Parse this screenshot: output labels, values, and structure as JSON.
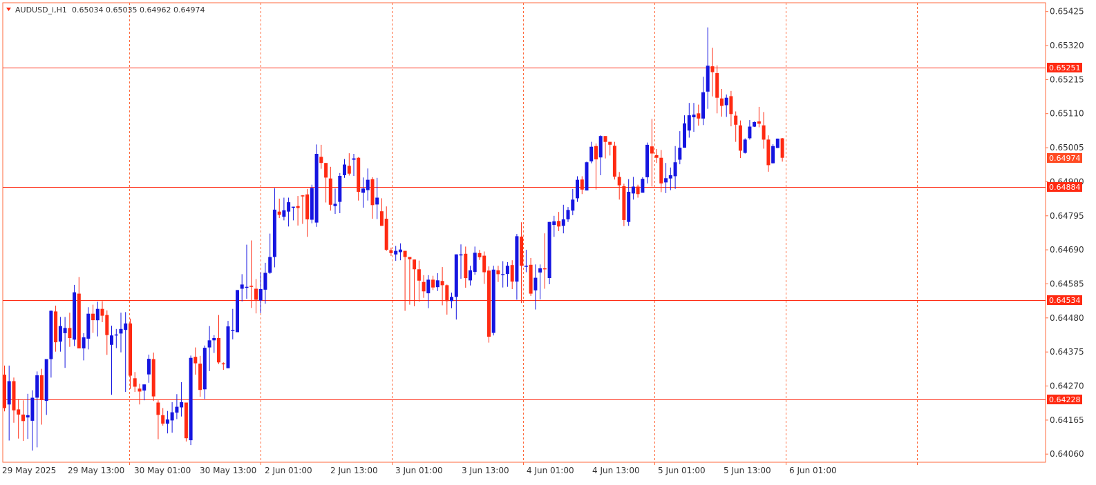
{
  "header": {
    "symbol": "AUDUSD_i,H1",
    "ohlc_text": "0.65034 0.65035 0.64962 0.64974"
  },
  "colors": {
    "bull": "#1515e0",
    "bear": "#ff2a12",
    "grid": "#ff6a3d",
    "axis": "#ff6a3d",
    "hline": "#ff2a12",
    "tag_bg": "#ff2a12",
    "current_tag_bg": "#ff4a22"
  },
  "chart_data": {
    "type": "candlestick",
    "timeframe": "H1",
    "symbol": "AUDUSD_i",
    "y_axis_ticks": [
      "0.65425",
      "0.65320",
      "0.65215",
      "0.65110",
      "0.65005",
      "0.64900",
      "0.64795",
      "0.64690",
      "0.64585",
      "0.64480",
      "0.64375",
      "0.64270",
      "0.64165",
      "0.64060"
    ],
    "ylim": [
      0.64035,
      0.65452
    ],
    "x_axis_labels": [
      "29 May 2025",
      "29 May 13:00",
      "30 May 01:00",
      "30 May 13:00",
      "2 Jun 01:00",
      "2 Jun 13:00",
      "3 Jun 01:00",
      "3 Jun 13:00",
      "4 Jun 01:00",
      "4 Jun 13:00",
      "5 Jun 01:00",
      "5 Jun 13:00",
      "6 Jun 01:00"
    ],
    "horizontal_levels": [
      {
        "value": "0.65251",
        "price": 0.65251
      },
      {
        "value": "0.64884",
        "price": 0.64884
      },
      {
        "value": "0.64534",
        "price": 0.64534
      },
      {
        "value": "0.64228",
        "price": 0.64228
      }
    ],
    "current_price": {
      "value": "0.64974",
      "price": 0.64974
    },
    "candles": [
      {
        "o": 0.64305,
        "h": 0.64333,
        "l": 0.64192,
        "c": 0.64202
      },
      {
        "o": 0.64213,
        "h": 0.64333,
        "l": 0.64102,
        "c": 0.64285
      },
      {
        "o": 0.64285,
        "h": 0.64296,
        "l": 0.64157,
        "c": 0.64195
      },
      {
        "o": 0.64198,
        "h": 0.6423,
        "l": 0.64108,
        "c": 0.64182
      },
      {
        "o": 0.64182,
        "h": 0.64226,
        "l": 0.64101,
        "c": 0.64162
      },
      {
        "o": 0.64173,
        "h": 0.64246,
        "l": 0.64107,
        "c": 0.6418
      },
      {
        "o": 0.64163,
        "h": 0.64257,
        "l": 0.64071,
        "c": 0.64234
      },
      {
        "o": 0.64234,
        "h": 0.64315,
        "l": 0.64081,
        "c": 0.64303
      },
      {
        "o": 0.64303,
        "h": 0.64323,
        "l": 0.64151,
        "c": 0.64228
      },
      {
        "o": 0.64224,
        "h": 0.64351,
        "l": 0.64181,
        "c": 0.64353
      },
      {
        "o": 0.64353,
        "h": 0.64503,
        "l": 0.64296,
        "c": 0.64502
      },
      {
        "o": 0.645,
        "h": 0.64518,
        "l": 0.64376,
        "c": 0.64405
      },
      {
        "o": 0.64407,
        "h": 0.64483,
        "l": 0.64376,
        "c": 0.64455
      },
      {
        "o": 0.64433,
        "h": 0.64483,
        "l": 0.64326,
        "c": 0.64449
      },
      {
        "o": 0.64449,
        "h": 0.64496,
        "l": 0.64391,
        "c": 0.64418
      },
      {
        "o": 0.64413,
        "h": 0.64582,
        "l": 0.64393,
        "c": 0.64559
      },
      {
        "o": 0.64555,
        "h": 0.64606,
        "l": 0.64413,
        "c": 0.64386
      },
      {
        "o": 0.64386,
        "h": 0.64433,
        "l": 0.64349,
        "c": 0.6442
      },
      {
        "o": 0.64416,
        "h": 0.64513,
        "l": 0.64383,
        "c": 0.64493
      },
      {
        "o": 0.64493,
        "h": 0.64521,
        "l": 0.64434,
        "c": 0.64473
      },
      {
        "o": 0.64473,
        "h": 0.6453,
        "l": 0.64423,
        "c": 0.64508
      },
      {
        "o": 0.64508,
        "h": 0.64532,
        "l": 0.64467,
        "c": 0.64487
      },
      {
        "o": 0.64489,
        "h": 0.64503,
        "l": 0.64366,
        "c": 0.64427
      },
      {
        "o": 0.64397,
        "h": 0.64456,
        "l": 0.64243,
        "c": 0.64426
      },
      {
        "o": 0.64426,
        "h": 0.64446,
        "l": 0.64387,
        "c": 0.64429
      },
      {
        "o": 0.64432,
        "h": 0.64496,
        "l": 0.64374,
        "c": 0.64446
      },
      {
        "o": 0.64443,
        "h": 0.64498,
        "l": 0.64252,
        "c": 0.64463
      },
      {
        "o": 0.64463,
        "h": 0.64478,
        "l": 0.64261,
        "c": 0.64302
      },
      {
        "o": 0.64294,
        "h": 0.64313,
        "l": 0.64252,
        "c": 0.64268
      },
      {
        "o": 0.64262,
        "h": 0.64277,
        "l": 0.64213,
        "c": 0.64253
      },
      {
        "o": 0.64256,
        "h": 0.64272,
        "l": 0.64226,
        "c": 0.64275
      },
      {
        "o": 0.64306,
        "h": 0.64367,
        "l": 0.6428,
        "c": 0.64354
      },
      {
        "o": 0.64353,
        "h": 0.64373,
        "l": 0.64224,
        "c": 0.64238
      },
      {
        "o": 0.64219,
        "h": 0.64226,
        "l": 0.64106,
        "c": 0.64181
      },
      {
        "o": 0.6418,
        "h": 0.64202,
        "l": 0.64148,
        "c": 0.64154
      },
      {
        "o": 0.64154,
        "h": 0.64193,
        "l": 0.64124,
        "c": 0.64167
      },
      {
        "o": 0.64164,
        "h": 0.6422,
        "l": 0.64126,
        "c": 0.64189
      },
      {
        "o": 0.64188,
        "h": 0.64245,
        "l": 0.64168,
        "c": 0.64206
      },
      {
        "o": 0.64204,
        "h": 0.64282,
        "l": 0.64176,
        "c": 0.6422
      },
      {
        "o": 0.64219,
        "h": 0.64216,
        "l": 0.64099,
        "c": 0.64109
      },
      {
        "o": 0.64103,
        "h": 0.64364,
        "l": 0.64088,
        "c": 0.64357
      },
      {
        "o": 0.6436,
        "h": 0.64389,
        "l": 0.64305,
        "c": 0.6434
      },
      {
        "o": 0.64339,
        "h": 0.64363,
        "l": 0.64237,
        "c": 0.64258
      },
      {
        "o": 0.6426,
        "h": 0.64395,
        "l": 0.6423,
        "c": 0.64388
      },
      {
        "o": 0.64389,
        "h": 0.64455,
        "l": 0.64316,
        "c": 0.64411
      },
      {
        "o": 0.64411,
        "h": 0.64427,
        "l": 0.64372,
        "c": 0.64418
      },
      {
        "o": 0.64418,
        "h": 0.64489,
        "l": 0.64338,
        "c": 0.64343
      },
      {
        "o": 0.6434,
        "h": 0.64343,
        "l": 0.6432,
        "c": 0.64337
      },
      {
        "o": 0.64325,
        "h": 0.64471,
        "l": 0.6434,
        "c": 0.64454
      },
      {
        "o": 0.64443,
        "h": 0.64508,
        "l": 0.64414,
        "c": 0.64443
      },
      {
        "o": 0.64436,
        "h": 0.64562,
        "l": 0.64437,
        "c": 0.64566
      },
      {
        "o": 0.6457,
        "h": 0.64615,
        "l": 0.64531,
        "c": 0.64583
      },
      {
        "o": 0.64574,
        "h": 0.64706,
        "l": 0.64539,
        "c": 0.64576
      },
      {
        "o": 0.64579,
        "h": 0.64719,
        "l": 0.64511,
        "c": 0.64576
      },
      {
        "o": 0.6457,
        "h": 0.646,
        "l": 0.64494,
        "c": 0.64536
      },
      {
        "o": 0.64534,
        "h": 0.6462,
        "l": 0.64495,
        "c": 0.64569
      },
      {
        "o": 0.64567,
        "h": 0.6465,
        "l": 0.64524,
        "c": 0.64619
      },
      {
        "o": 0.64619,
        "h": 0.6474,
        "l": 0.64616,
        "c": 0.64668
      },
      {
        "o": 0.64668,
        "h": 0.6488,
        "l": 0.64636,
        "c": 0.64814
      },
      {
        "o": 0.64808,
        "h": 0.64848,
        "l": 0.64788,
        "c": 0.64798
      },
      {
        "o": 0.64792,
        "h": 0.64851,
        "l": 0.64781,
        "c": 0.64812
      },
      {
        "o": 0.64808,
        "h": 0.64851,
        "l": 0.64762,
        "c": 0.64837
      },
      {
        "o": 0.6482,
        "h": 0.64823,
        "l": 0.64781,
        "c": 0.64823
      },
      {
        "o": 0.64825,
        "h": 0.64856,
        "l": 0.64765,
        "c": 0.64819
      },
      {
        "o": 0.64858,
        "h": 0.64859,
        "l": 0.6477,
        "c": 0.64856
      },
      {
        "o": 0.64861,
        "h": 0.64878,
        "l": 0.6473,
        "c": 0.64784
      },
      {
        "o": 0.64783,
        "h": 0.64891,
        "l": 0.64772,
        "c": 0.64881
      },
      {
        "o": 0.64774,
        "h": 0.65015,
        "l": 0.64761,
        "c": 0.64986
      },
      {
        "o": 0.64977,
        "h": 0.65014,
        "l": 0.6494,
        "c": 0.64958
      },
      {
        "o": 0.64958,
        "h": 0.64954,
        "l": 0.64836,
        "c": 0.64913
      },
      {
        "o": 0.6491,
        "h": 0.64946,
        "l": 0.64811,
        "c": 0.64829
      },
      {
        "o": 0.64825,
        "h": 0.64879,
        "l": 0.64801,
        "c": 0.64832
      },
      {
        "o": 0.64838,
        "h": 0.64927,
        "l": 0.64803,
        "c": 0.64918
      },
      {
        "o": 0.6492,
        "h": 0.6497,
        "l": 0.64912,
        "c": 0.64953
      },
      {
        "o": 0.64949,
        "h": 0.64988,
        "l": 0.64919,
        "c": 0.64925
      },
      {
        "o": 0.64968,
        "h": 0.64986,
        "l": 0.64918,
        "c": 0.64972
      },
      {
        "o": 0.64974,
        "h": 0.64976,
        "l": 0.64842,
        "c": 0.64869
      },
      {
        "o": 0.64866,
        "h": 0.64913,
        "l": 0.6482,
        "c": 0.64879
      },
      {
        "o": 0.64874,
        "h": 0.64941,
        "l": 0.64842,
        "c": 0.64906
      },
      {
        "o": 0.64908,
        "h": 0.64914,
        "l": 0.64786,
        "c": 0.64828
      },
      {
        "o": 0.6483,
        "h": 0.64912,
        "l": 0.64785,
        "c": 0.64851
      },
      {
        "o": 0.64809,
        "h": 0.64849,
        "l": 0.64782,
        "c": 0.64764
      },
      {
        "o": 0.64786,
        "h": 0.64824,
        "l": 0.64687,
        "c": 0.6469
      },
      {
        "o": 0.64689,
        "h": 0.64697,
        "l": 0.64671,
        "c": 0.6468
      },
      {
        "o": 0.64676,
        "h": 0.64702,
        "l": 0.64656,
        "c": 0.64687
      },
      {
        "o": 0.64683,
        "h": 0.6471,
        "l": 0.64658,
        "c": 0.64691
      },
      {
        "o": 0.64687,
        "h": 0.64684,
        "l": 0.64502,
        "c": 0.64668
      },
      {
        "o": 0.64668,
        "h": 0.64668,
        "l": 0.64521,
        "c": 0.64661
      },
      {
        "o": 0.6466,
        "h": 0.64651,
        "l": 0.64516,
        "c": 0.6463
      },
      {
        "o": 0.6463,
        "h": 0.64657,
        "l": 0.6453,
        "c": 0.64595
      },
      {
        "o": 0.64591,
        "h": 0.64612,
        "l": 0.64542,
        "c": 0.64562
      },
      {
        "o": 0.64556,
        "h": 0.64612,
        "l": 0.6451,
        "c": 0.64598
      },
      {
        "o": 0.64598,
        "h": 0.6461,
        "l": 0.64566,
        "c": 0.64574
      },
      {
        "o": 0.64575,
        "h": 0.64618,
        "l": 0.64563,
        "c": 0.64596
      },
      {
        "o": 0.64594,
        "h": 0.64637,
        "l": 0.64519,
        "c": 0.64581
      },
      {
        "o": 0.64581,
        "h": 0.64583,
        "l": 0.6449,
        "c": 0.64532
      },
      {
        "o": 0.64532,
        "h": 0.64558,
        "l": 0.6451,
        "c": 0.64545
      },
      {
        "o": 0.64545,
        "h": 0.64661,
        "l": 0.64475,
        "c": 0.64676
      },
      {
        "o": 0.64676,
        "h": 0.64707,
        "l": 0.64601,
        "c": 0.64676
      },
      {
        "o": 0.64678,
        "h": 0.647,
        "l": 0.64573,
        "c": 0.64603
      },
      {
        "o": 0.64596,
        "h": 0.64641,
        "l": 0.6458,
        "c": 0.64627
      },
      {
        "o": 0.64622,
        "h": 0.647,
        "l": 0.64613,
        "c": 0.64681
      },
      {
        "o": 0.6468,
        "h": 0.6469,
        "l": 0.64659,
        "c": 0.64667
      },
      {
        "o": 0.64672,
        "h": 0.64685,
        "l": 0.64585,
        "c": 0.64621
      },
      {
        "o": 0.64626,
        "h": 0.64639,
        "l": 0.64404,
        "c": 0.64422
      },
      {
        "o": 0.64434,
        "h": 0.64641,
        "l": 0.64426,
        "c": 0.64629
      },
      {
        "o": 0.64627,
        "h": 0.64641,
        "l": 0.64591,
        "c": 0.64615
      },
      {
        "o": 0.64614,
        "h": 0.64655,
        "l": 0.64574,
        "c": 0.64615
      },
      {
        "o": 0.64616,
        "h": 0.64652,
        "l": 0.64576,
        "c": 0.64641
      },
      {
        "o": 0.64643,
        "h": 0.64658,
        "l": 0.64569,
        "c": 0.64592
      },
      {
        "o": 0.64592,
        "h": 0.64739,
        "l": 0.64536,
        "c": 0.64732
      },
      {
        "o": 0.64731,
        "h": 0.64775,
        "l": 0.64526,
        "c": 0.64641
      },
      {
        "o": 0.64641,
        "h": 0.6469,
        "l": 0.64621,
        "c": 0.64641
      },
      {
        "o": 0.64644,
        "h": 0.64665,
        "l": 0.64548,
        "c": 0.64555
      },
      {
        "o": 0.64565,
        "h": 0.64645,
        "l": 0.64506,
        "c": 0.64604
      },
      {
        "o": 0.6462,
        "h": 0.64645,
        "l": 0.64537,
        "c": 0.64633
      },
      {
        "o": 0.64633,
        "h": 0.64741,
        "l": 0.6457,
        "c": 0.6463
      },
      {
        "o": 0.64603,
        "h": 0.64772,
        "l": 0.64584,
        "c": 0.64776
      },
      {
        "o": 0.64767,
        "h": 0.64795,
        "l": 0.6473,
        "c": 0.64778
      },
      {
        "o": 0.64779,
        "h": 0.64807,
        "l": 0.64748,
        "c": 0.64762
      },
      {
        "o": 0.64764,
        "h": 0.64829,
        "l": 0.64741,
        "c": 0.64784
      },
      {
        "o": 0.64784,
        "h": 0.64822,
        "l": 0.64776,
        "c": 0.64813
      },
      {
        "o": 0.64811,
        "h": 0.64878,
        "l": 0.64797,
        "c": 0.64845
      },
      {
        "o": 0.64849,
        "h": 0.64917,
        "l": 0.64838,
        "c": 0.64906
      },
      {
        "o": 0.64907,
        "h": 0.64917,
        "l": 0.64862,
        "c": 0.64876
      },
      {
        "o": 0.64873,
        "h": 0.64962,
        "l": 0.64873,
        "c": 0.6496
      },
      {
        "o": 0.64963,
        "h": 0.65023,
        "l": 0.64957,
        "c": 0.65008
      },
      {
        "o": 0.6501,
        "h": 0.65018,
        "l": 0.64876,
        "c": 0.64969
      },
      {
        "o": 0.64975,
        "h": 0.65043,
        "l": 0.6492,
        "c": 0.65041
      },
      {
        "o": 0.65041,
        "h": 0.6504,
        "l": 0.64972,
        "c": 0.65023
      },
      {
        "o": 0.65023,
        "h": 0.65015,
        "l": 0.64981,
        "c": 0.65014
      },
      {
        "o": 0.65011,
        "h": 0.65023,
        "l": 0.64907,
        "c": 0.64916
      },
      {
        "o": 0.64915,
        "h": 0.6493,
        "l": 0.64845,
        "c": 0.64889
      },
      {
        "o": 0.64886,
        "h": 0.64894,
        "l": 0.64763,
        "c": 0.64782
      },
      {
        "o": 0.64776,
        "h": 0.64908,
        "l": 0.64764,
        "c": 0.64869
      },
      {
        "o": 0.64864,
        "h": 0.64915,
        "l": 0.64845,
        "c": 0.64885
      },
      {
        "o": 0.64885,
        "h": 0.64891,
        "l": 0.64851,
        "c": 0.64862
      },
      {
        "o": 0.64866,
        "h": 0.64914,
        "l": 0.64879,
        "c": 0.64909
      },
      {
        "o": 0.64914,
        "h": 0.65021,
        "l": 0.64895,
        "c": 0.65014
      },
      {
        "o": 0.65009,
        "h": 0.65094,
        "l": 0.64885,
        "c": 0.64987
      },
      {
        "o": 0.64982,
        "h": 0.65001,
        "l": 0.64958,
        "c": 0.64974
      },
      {
        "o": 0.64974,
        "h": 0.64998,
        "l": 0.64868,
        "c": 0.64895
      },
      {
        "o": 0.64898,
        "h": 0.64958,
        "l": 0.64865,
        "c": 0.64911
      },
      {
        "o": 0.6491,
        "h": 0.64944,
        "l": 0.64874,
        "c": 0.6492
      },
      {
        "o": 0.64917,
        "h": 0.6501,
        "l": 0.64878,
        "c": 0.6496
      },
      {
        "o": 0.64968,
        "h": 0.65056,
        "l": 0.64954,
        "c": 0.65005
      },
      {
        "o": 0.65005,
        "h": 0.65105,
        "l": 0.65008,
        "c": 0.6508
      },
      {
        "o": 0.65058,
        "h": 0.65143,
        "l": 0.65036,
        "c": 0.65105
      },
      {
        "o": 0.65099,
        "h": 0.65143,
        "l": 0.65054,
        "c": 0.65107
      },
      {
        "o": 0.65111,
        "h": 0.65138,
        "l": 0.65073,
        "c": 0.65095
      },
      {
        "o": 0.65095,
        "h": 0.65224,
        "l": 0.65075,
        "c": 0.65176
      },
      {
        "o": 0.65178,
        "h": 0.65376,
        "l": 0.65125,
        "c": 0.65258
      },
      {
        "o": 0.65256,
        "h": 0.65313,
        "l": 0.65163,
        "c": 0.65238
      },
      {
        "o": 0.65235,
        "h": 0.65259,
        "l": 0.65111,
        "c": 0.65159
      },
      {
        "o": 0.65157,
        "h": 0.65186,
        "l": 0.65101,
        "c": 0.65134
      },
      {
        "o": 0.65136,
        "h": 0.65169,
        "l": 0.651,
        "c": 0.65159
      },
      {
        "o": 0.65164,
        "h": 0.6518,
        "l": 0.65071,
        "c": 0.65109
      },
      {
        "o": 0.65104,
        "h": 0.65117,
        "l": 0.65023,
        "c": 0.65076
      },
      {
        "o": 0.65074,
        "h": 0.65089,
        "l": 0.64973,
        "c": 0.64996
      },
      {
        "o": 0.64989,
        "h": 0.65034,
        "l": 0.64987,
        "c": 0.6503
      },
      {
        "o": 0.65034,
        "h": 0.6509,
        "l": 0.6503,
        "c": 0.6507
      },
      {
        "o": 0.6507,
        "h": 0.65086,
        "l": 0.65069,
        "c": 0.65084
      },
      {
        "o": 0.65086,
        "h": 0.65131,
        "l": 0.65068,
        "c": 0.65079
      },
      {
        "o": 0.65074,
        "h": 0.65115,
        "l": 0.65002,
        "c": 0.6503
      },
      {
        "o": 0.6503,
        "h": 0.65043,
        "l": 0.64931,
        "c": 0.64951
      },
      {
        "o": 0.64957,
        "h": 0.65016,
        "l": 0.64956,
        "c": 0.6501
      },
      {
        "o": 0.65004,
        "h": 0.6503,
        "l": 0.65004,
        "c": 0.65033
      },
      {
        "o": 0.65034,
        "h": 0.65035,
        "l": 0.64962,
        "c": 0.64974
      }
    ]
  }
}
